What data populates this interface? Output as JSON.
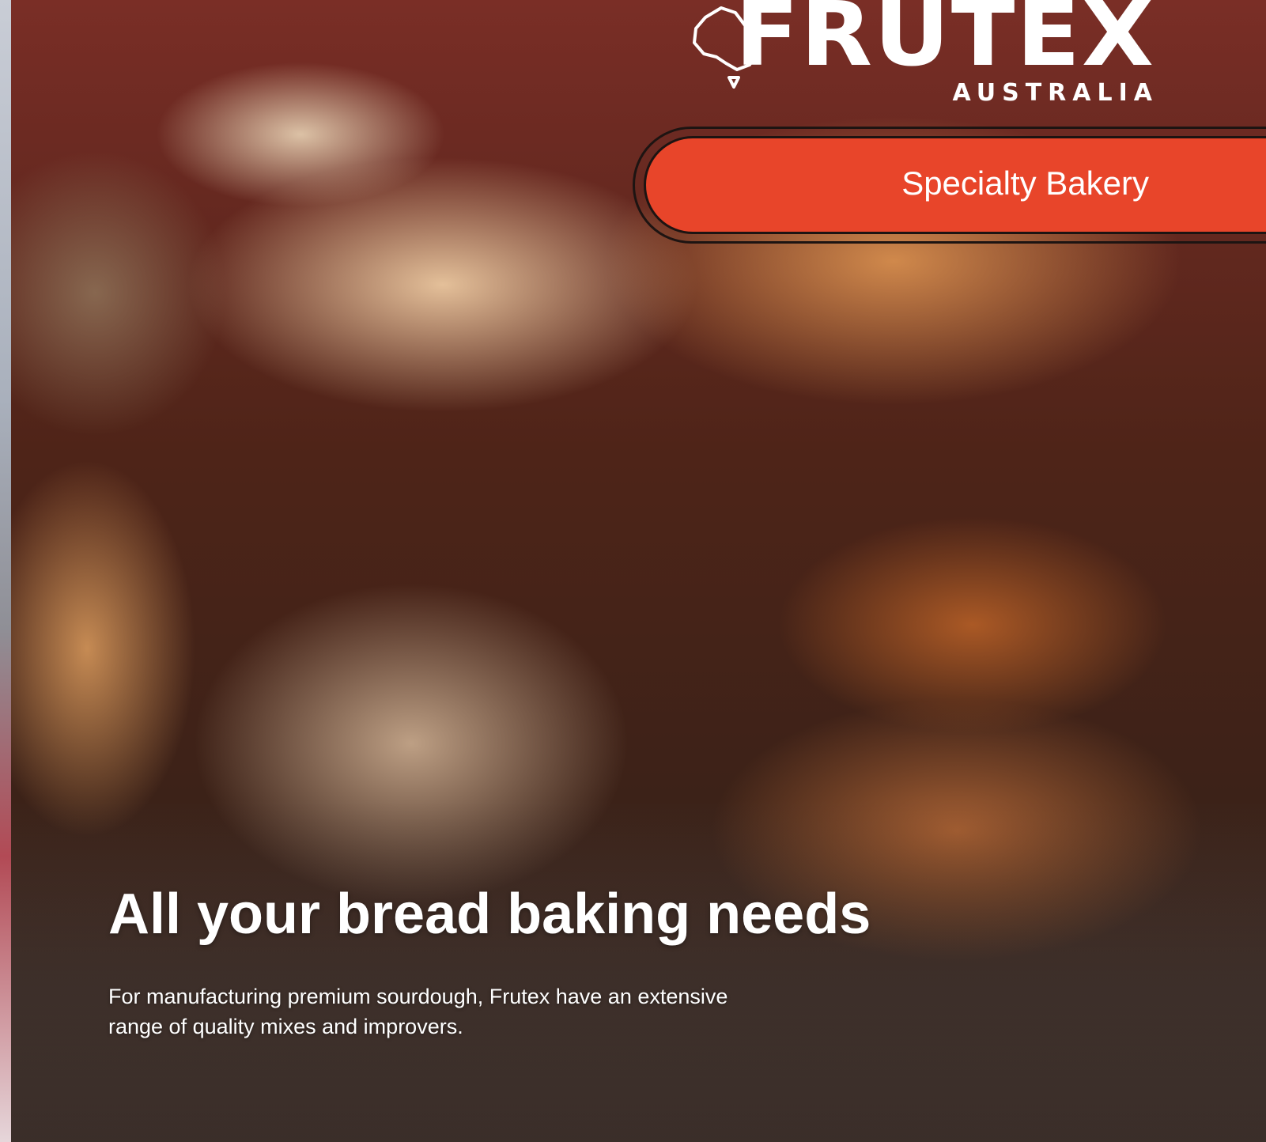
{
  "brand": {
    "name": "FRUTEX",
    "region": "AUSTRALIA",
    "logo_icon": "australia-map-icon"
  },
  "category": {
    "label": "Specialty Bakery",
    "color": "#e8452a"
  },
  "headline": "All your bread baking needs",
  "body": "For manufacturing premium sourdough, Frutex have an extensive range of quality mixes and improvers.",
  "hero_image": "bread-and-pastries-photo"
}
